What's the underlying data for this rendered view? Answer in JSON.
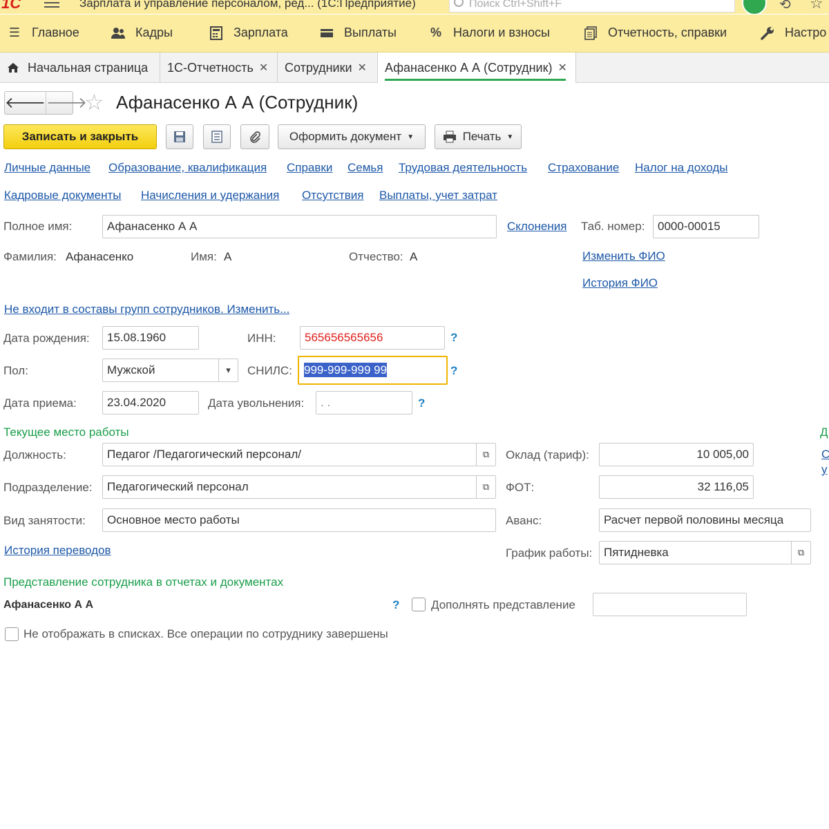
{
  "titlebar": {
    "logo": "1С",
    "window_title": "Зарплата и управление персоналом, ред...  (1С:Предприятие)",
    "search_placeholder": "Поиск Ctrl+Shift+F"
  },
  "sections": [
    {
      "label": "Главное",
      "icon": "menu-lines-icon"
    },
    {
      "label": "Кадры",
      "icon": "people-icon"
    },
    {
      "label": "Зарплата",
      "icon": "calculator-icon"
    },
    {
      "label": "Выплаты",
      "icon": "wallet-icon"
    },
    {
      "label": "Налоги и взносы",
      "icon": "percent-icon"
    },
    {
      "label": "Отчетность, справки",
      "icon": "reports-icon"
    },
    {
      "label": "Настро",
      "icon": "wrench-icon"
    }
  ],
  "tabs": [
    {
      "label": "Начальная страница",
      "icon": "home-icon"
    },
    {
      "label": "1С-Отчетность"
    },
    {
      "label": "Сотрудники"
    },
    {
      "label": "Афанасенко А А (Сотрудник)"
    }
  ],
  "form": {
    "title": "Афанасенко А А (Сотрудник)",
    "toolbar": {
      "save_close": "Записать и закрыть",
      "create_doc": "Оформить документ",
      "print": "Печать"
    },
    "links_row1": [
      "Личные данные",
      "Образование, квалификация",
      "Справки",
      "Семья",
      "Трудовая деятельность",
      "Страхование",
      "Налог на доходы"
    ],
    "links_row2": [
      "Кадровые документы",
      "Начисления и удержания",
      "Отсутствия",
      "Выплаты, учет затрат"
    ],
    "full_name_label": "Полное имя:",
    "full_name": "Афанасенко А А",
    "declensions_link": "Склонения",
    "tab_number_label": "Таб. номер:",
    "tab_number": "0000-00015",
    "surname_label": "Фамилия:",
    "surname": "Афанасенко",
    "first_name_label": "Имя:",
    "first_name": "А",
    "patronymic_label": "Отчество:",
    "patronymic": "А",
    "change_fio_link": "Изменить ФИО",
    "history_fio_link": "История ФИО",
    "groups_link": "Не входит в составы групп сотрудников. Изменить...",
    "birth_label": "Дата рождения:",
    "birth_date": "15.08.1960",
    "inn_label": "ИНН:",
    "inn": "565656565656",
    "gender_label": "Пол:",
    "gender": "Мужской",
    "snils_label": "СНИЛС:",
    "snils": "999-999-999 99",
    "hire_label": "Дата приема:",
    "hire_date": "23.04.2020",
    "dismiss_label": "Дата увольнения:",
    "dismiss_date": " .  .",
    "help": "?",
    "current_job_title": "Текущее место работы",
    "position_label": "Должность:",
    "position": "Педагог /Педагогический персонал/",
    "department_label": "Подразделение:",
    "department": "Педагогический персонал",
    "employment_label": "Вид занятости:",
    "employment": "Основное место работы",
    "transfers_link": "История переводов",
    "salary_label": "Оклад (тариф):",
    "salary": "10 005,00",
    "fot_label": "ФОТ:",
    "fot": "32 116,05",
    "advance_label": "Аванс:",
    "advance": "Расчет первой половины месяца",
    "schedule_label": "График работы:",
    "schedule": "Пятидневка",
    "right_edge": {
      "top": "Д",
      "l1": "С",
      "l2": "у"
    },
    "presentation_title": "Представление сотрудника в отчетах и документах",
    "presentation": "Афанасенко А А",
    "supplement_label": "Дополнять представление",
    "supplement_value": "",
    "hide_label": "Не отображать в списках. Все операции по сотруднику завершены"
  },
  "colors": {
    "menu_bg": "#fbeca0",
    "primary_button": "#f3ce0f",
    "link": "#1d58a8",
    "group_title": "#1a9e4a",
    "inn_text": "#e0201c",
    "snils_selection": "#3a62c9",
    "focus_border": "#f0b400"
  }
}
